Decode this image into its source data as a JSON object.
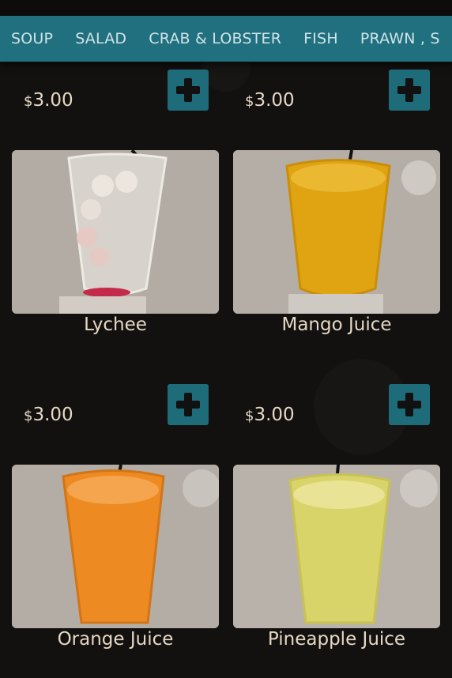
{
  "categories": [
    "SOUP",
    "SALAD",
    "CRAB & LOBSTER",
    "FISH",
    "PRAWN , S"
  ],
  "products": [
    {
      "name": "Lychee",
      "currency": "$",
      "price": "3.00",
      "drink_color": "#cfc8c0"
    },
    {
      "name": "Mango Juice",
      "currency": "$",
      "price": "3.00",
      "drink_color": "#e0a312"
    },
    {
      "name": "Orange Juice",
      "currency": "$",
      "price": "3.00",
      "drink_color": "#ee8a22"
    },
    {
      "name": "Pineapple Juice",
      "currency": "$",
      "price": "3.00",
      "drink_color": "#d9d46a"
    }
  ],
  "colors": {
    "accent": "#20707f",
    "button": "#1e6b7a",
    "background": "#121110",
    "text": "#e6d8c4"
  },
  "icons": {
    "add": "plus-icon"
  }
}
